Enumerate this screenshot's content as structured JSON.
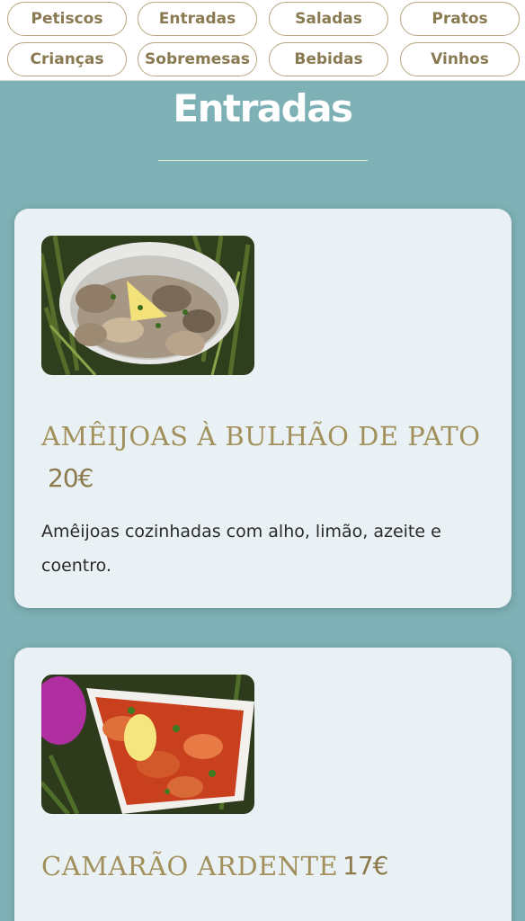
{
  "nav": {
    "categories": [
      "Petiscos",
      "Entradas",
      "Saladas",
      "Pratos",
      "Crianças",
      "Sobremesas",
      "Bebidas",
      "Vinhos"
    ]
  },
  "section": {
    "title": "Entradas"
  },
  "items": [
    {
      "name": "AMÊIJOAS À BULHÃO DE PATO",
      "price": "20€",
      "description": "Amêijoas cozinhadas com alho, limão, azeite e coentro."
    },
    {
      "name": "CAMARÃO ARDENTE",
      "price": "17€"
    }
  ],
  "colors": {
    "background": "#7eb1b6",
    "card": "#eaf1f4",
    "accent_gold": "#a2905c",
    "nav_border": "#b7a680"
  }
}
